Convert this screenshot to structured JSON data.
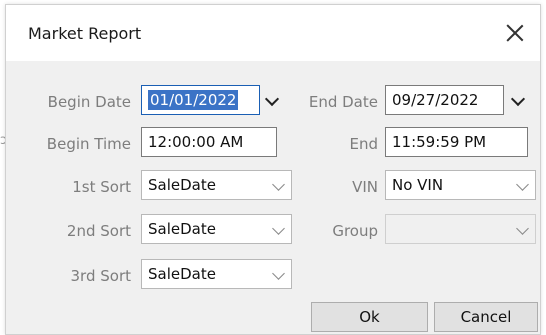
{
  "window": {
    "title": "Market Report"
  },
  "left_edge_text": "ɔt",
  "fields": {
    "begin_date": {
      "label": "Begin Date",
      "value": "01/01/2022"
    },
    "end_date": {
      "label": "End Date",
      "value": "09/27/2022"
    },
    "begin_time": {
      "label": "Begin Time",
      "value": "12:00:00 AM"
    },
    "end_time": {
      "label": "End",
      "value": "11:59:59 PM"
    },
    "sort1": {
      "label": "1st Sort",
      "value": "SaleDate"
    },
    "sort2": {
      "label": "2nd Sort",
      "value": "SaleDate"
    },
    "sort3": {
      "label": "3rd Sort",
      "value": "SaleDate"
    },
    "vin": {
      "label": "VIN",
      "value": "No VIN"
    },
    "group": {
      "label": "Group",
      "value": ""
    }
  },
  "buttons": {
    "ok": "Ok",
    "cancel": "Cancel"
  },
  "colors": {
    "selection": "#3b73c6",
    "window_bg": "#f0f0f0",
    "label": "#7d7d7d"
  }
}
